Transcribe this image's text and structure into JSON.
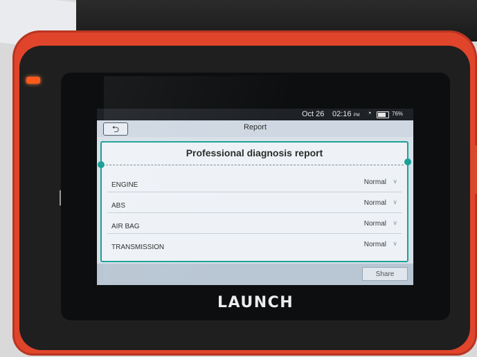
{
  "status_bar": {
    "date": "Oct 26",
    "time": "02:16",
    "ampm": "PM",
    "battery": "76%"
  },
  "titlebar": {
    "back_icon": "undo-arrow",
    "title": "Report"
  },
  "report": {
    "title": "Professional diagnosis report",
    "rows": [
      {
        "name": "ENGINE",
        "status": "Normal"
      },
      {
        "name": "ABS",
        "status": "Normal"
      },
      {
        "name": "AIR BAG",
        "status": "Normal"
      },
      {
        "name": "TRANSMISSION",
        "status": "Normal"
      }
    ]
  },
  "footer": {
    "share_label": "Share"
  },
  "device": {
    "logo": "LAUNCH"
  },
  "colors": {
    "device_body": "#e0452b",
    "card_border": "#1aa198",
    "led": "#ff5a1c"
  }
}
